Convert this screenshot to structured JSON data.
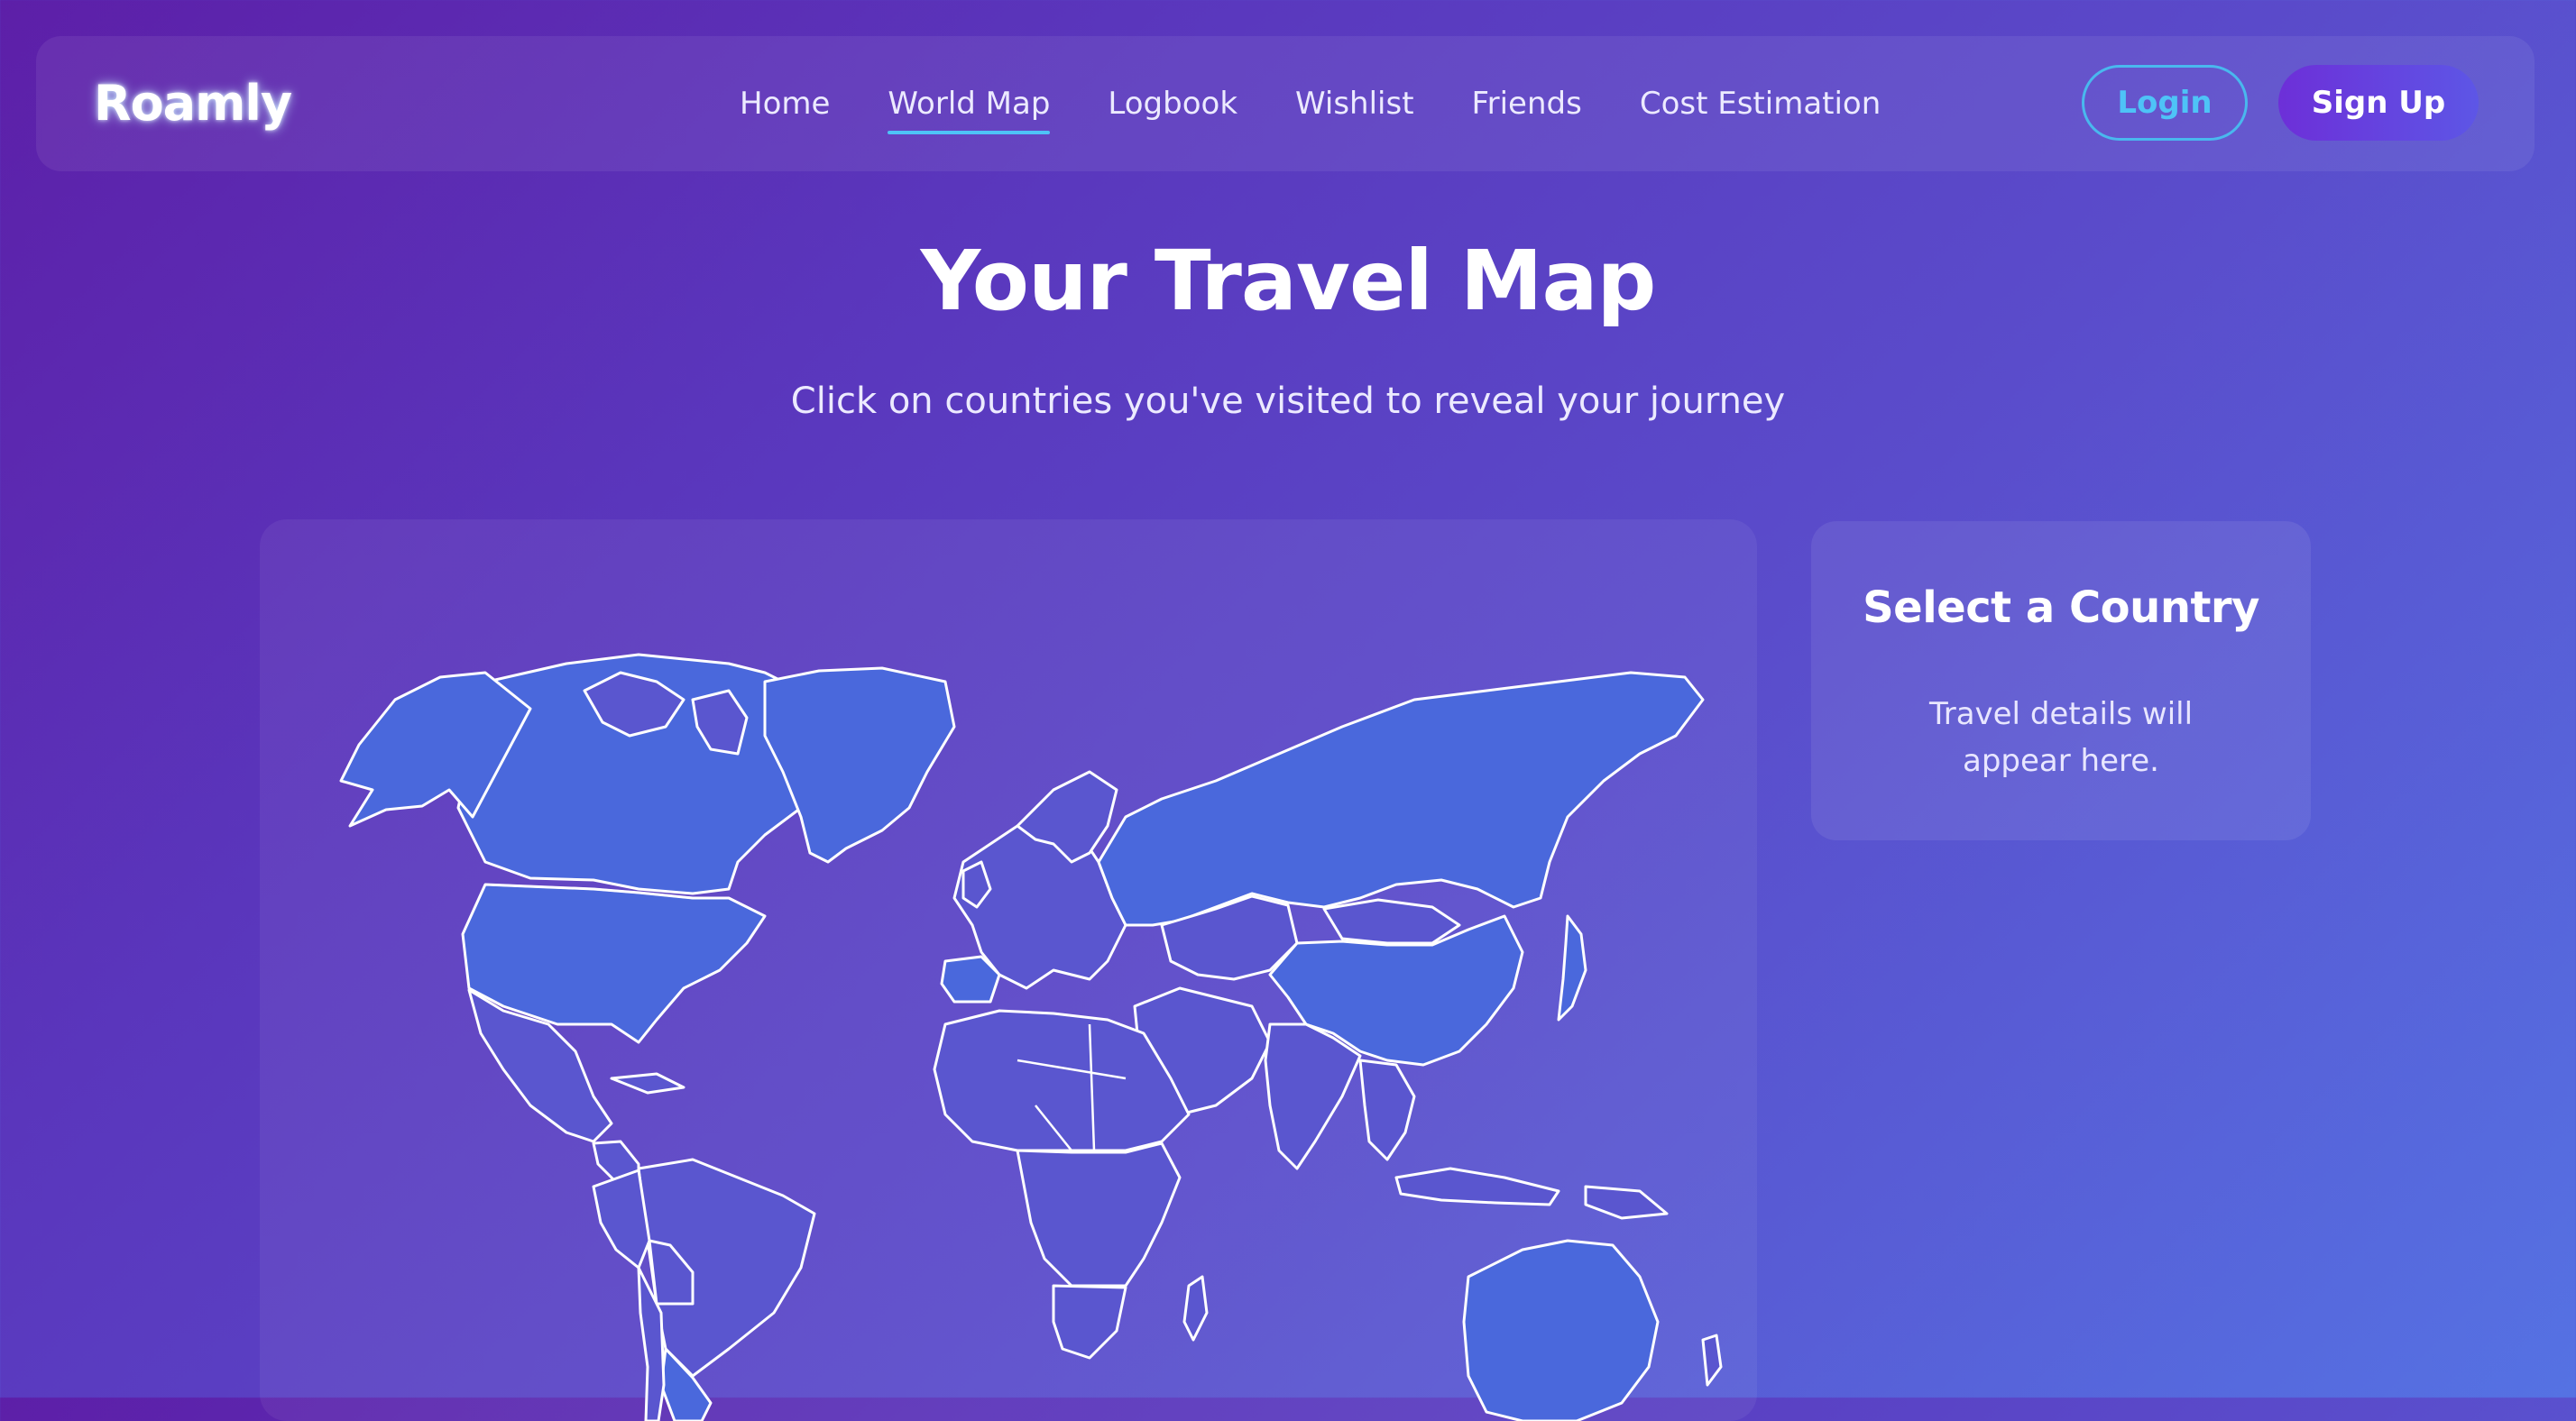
{
  "brand": {
    "name": "Roamly"
  },
  "nav": {
    "links": [
      {
        "label": "Home",
        "active": false
      },
      {
        "label": "World Map",
        "active": true
      },
      {
        "label": "Logbook",
        "active": false
      },
      {
        "label": "Wishlist",
        "active": false
      },
      {
        "label": "Friends",
        "active": false
      },
      {
        "label": "Cost Estimation",
        "active": false
      }
    ],
    "login_label": "Login",
    "signup_label": "Sign Up"
  },
  "hero": {
    "title": "Your Travel Map",
    "subtitle": "Click on countries you've visited to reveal your journey"
  },
  "info_panel": {
    "title": "Select a Country",
    "text": "Travel details will appear here."
  },
  "colors": {
    "accent": "#4ec3f7",
    "visited_country": "#4a68dc",
    "unvisited_country": "#5a56cf"
  }
}
